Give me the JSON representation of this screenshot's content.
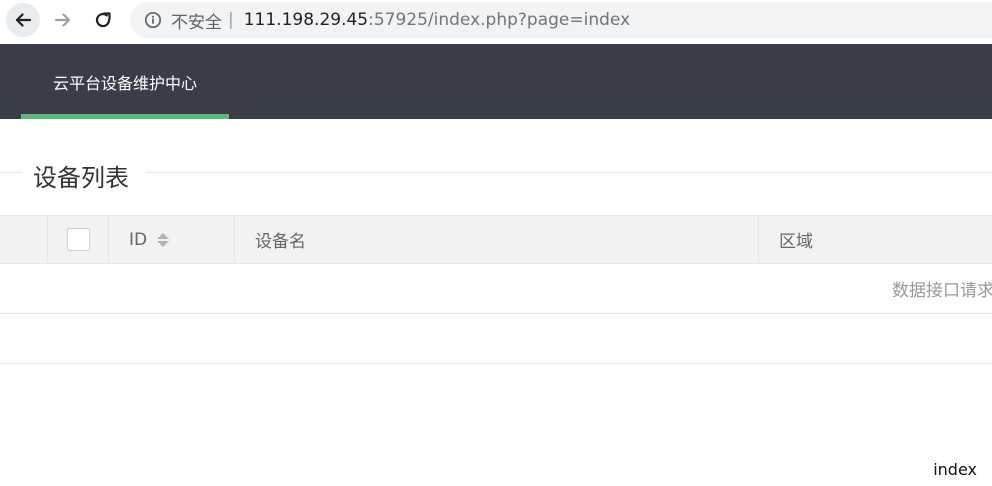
{
  "browser": {
    "security_label": "不安全",
    "separator": "|",
    "url_host": "111.198.29.45",
    "url_rest": ":57925/index.php?page=index",
    "icons": {
      "back": "arrow-left-icon",
      "forward": "arrow-right-icon",
      "reload": "reload-icon",
      "info": "info-circle-icon"
    }
  },
  "header": {
    "title": "云平台设备维护中心",
    "background": "#393d49",
    "accent": "#5fb878"
  },
  "section": {
    "title": "设备列表"
  },
  "table": {
    "columns": [
      "ID",
      "设备名",
      "区域"
    ],
    "empty_message": "数据接口请求"
  },
  "footer": {
    "text": "index"
  }
}
